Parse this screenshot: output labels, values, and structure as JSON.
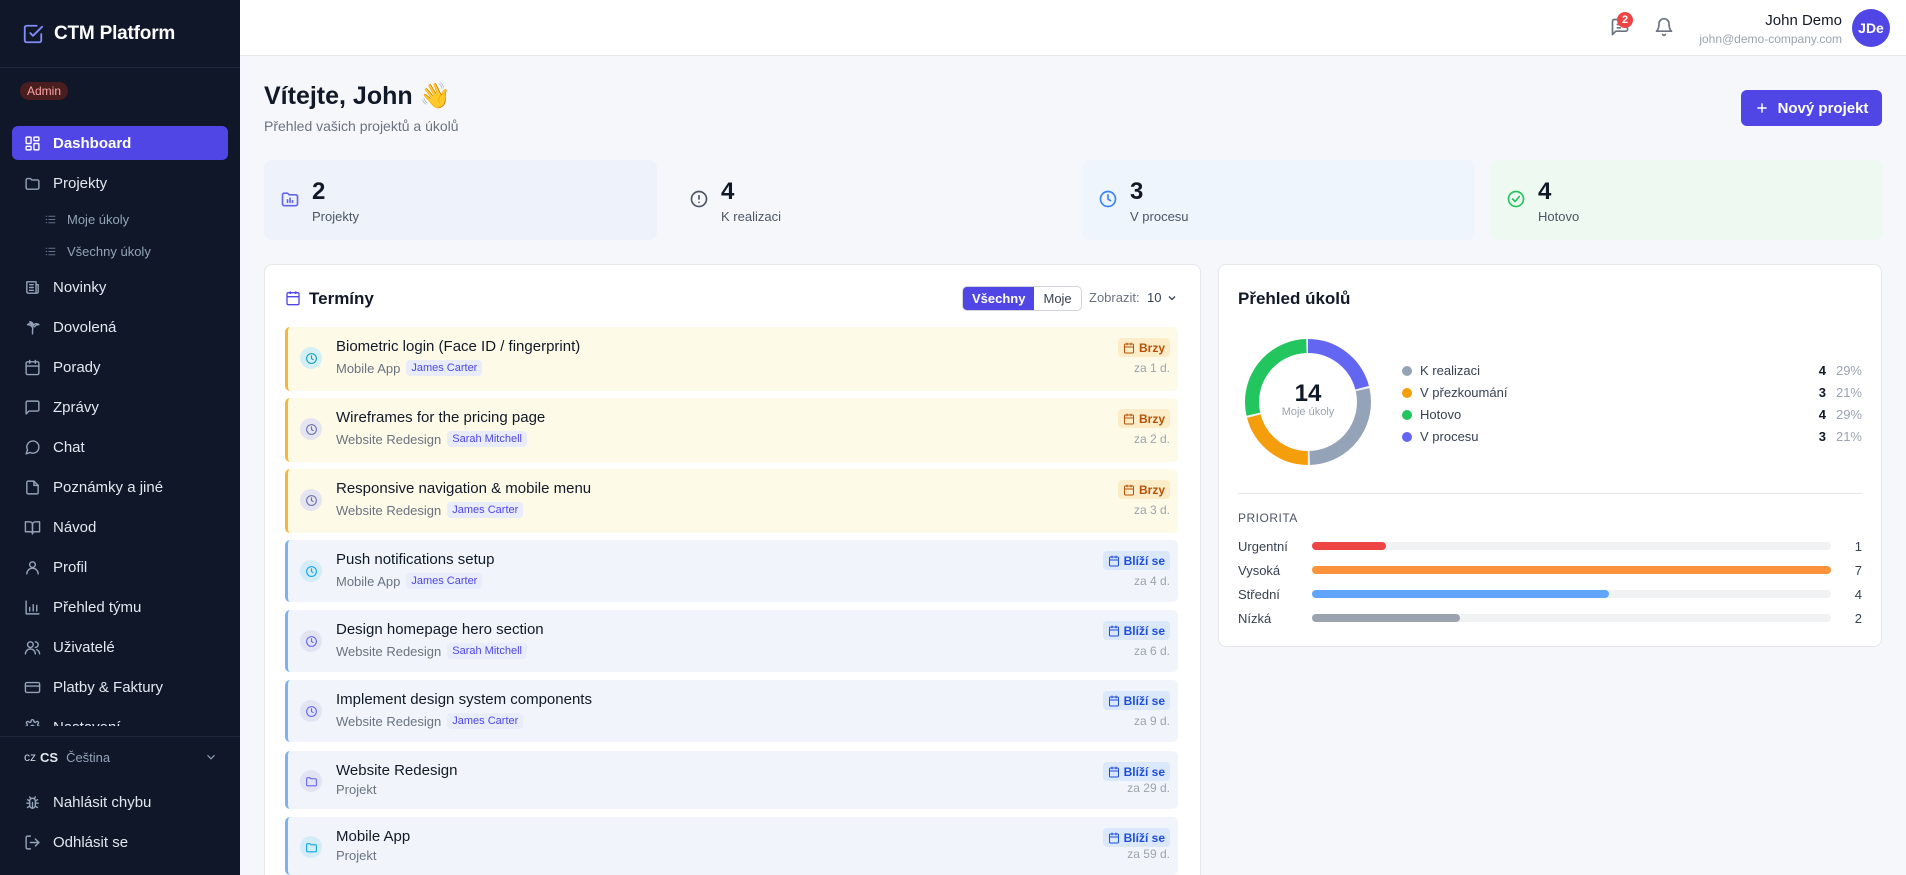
{
  "app": {
    "name": "CTM Platform",
    "role": "Admin"
  },
  "nav": [
    {
      "label": "Dashboard",
      "icon": "dashboard-icon",
      "active": true
    },
    {
      "label": "Projekty",
      "icon": "folder-icon"
    },
    {
      "label": "Moje úkoly",
      "icon": "list-icon",
      "sub": true
    },
    {
      "label": "Všechny úkoly",
      "icon": "list-icon",
      "sub": true
    },
    {
      "label": "Novinky",
      "icon": "newspaper-icon"
    },
    {
      "label": "Dovolená",
      "icon": "palm-icon"
    },
    {
      "label": "Porady",
      "icon": "calendar-icon"
    },
    {
      "label": "Zprávy",
      "icon": "message-icon"
    },
    {
      "label": "Chat",
      "icon": "chat-icon"
    },
    {
      "label": "Poznámky a jiné",
      "icon": "file-icon"
    },
    {
      "label": "Návod",
      "icon": "book-icon"
    },
    {
      "label": "Profil",
      "icon": "user-icon"
    },
    {
      "label": "Přehled týmu",
      "icon": "bar-chart-icon"
    },
    {
      "label": "Uživatelé",
      "icon": "users-icon"
    },
    {
      "label": "Platby & Faktury",
      "icon": "credit-card-icon"
    },
    {
      "label": "Nastavení",
      "icon": "gear-icon"
    }
  ],
  "language": {
    "flag": "cz",
    "code": "CS",
    "name": "Čeština"
  },
  "bottom": {
    "report": "Nahlásit chybu",
    "logout": "Odhlásit se"
  },
  "topbar": {
    "badge": "2",
    "user_name": "John Demo",
    "user_email": "john@demo-company.com",
    "avatar": "JDe"
  },
  "header": {
    "title": "Vítejte, John 👋",
    "subtitle": "Přehled vašich projektů a úkolů",
    "new_project": "Nový projekt"
  },
  "stats": [
    {
      "value": "2",
      "label": "Projekty",
      "icon": "folder-chart-icon",
      "bg": "#eef2fb",
      "color": "#6366f1"
    },
    {
      "value": "4",
      "label": "K realizaci",
      "icon": "alert-circle-icon",
      "bg": "#f5f7fb",
      "color": "#4b5563"
    },
    {
      "value": "3",
      "label": "V procesu",
      "icon": "clock-icon",
      "bg": "#eef5fd",
      "color": "#3b82f6"
    },
    {
      "value": "4",
      "label": "Hotovo",
      "icon": "check-circle-icon",
      "bg": "#eefaf1",
      "color": "#22c55e"
    }
  ],
  "deadlines": {
    "title": "Termíny",
    "filter_all": "Všechny",
    "filter_mine": "Moje",
    "show_label": "Zobrazit:",
    "show_value": "10",
    "items": [
      {
        "title": "Biometric login (Face ID / fingerprint)",
        "project": "Mobile App",
        "assignee": "James Carter",
        "tag": "Brzy",
        "due": "za 1 d.",
        "kind": "soon",
        "icon": "task",
        "icon_bg": "#d5f0f4",
        "icon_color": "#0e9fb5"
      },
      {
        "title": "Wireframes for the pricing page",
        "project": "Website Redesign",
        "assignee": "Sarah Mitchell",
        "tag": "Brzy",
        "due": "za 2 d.",
        "kind": "soon",
        "icon": "task",
        "icon_bg": "#e4e5f0",
        "icon_color": "#6b6fa8"
      },
      {
        "title": "Responsive navigation & mobile menu",
        "project": "Website Redesign",
        "assignee": "James Carter",
        "tag": "Brzy",
        "due": "za 3 d.",
        "kind": "soon",
        "icon": "task",
        "icon_bg": "#e4e5f0",
        "icon_color": "#6b6fa8"
      },
      {
        "title": "Push notifications setup",
        "project": "Mobile App",
        "assignee": "James Carter",
        "tag": "Blíží se",
        "due": "za 4 d.",
        "kind": "near",
        "icon": "task",
        "icon_bg": "#d3ecf8",
        "icon_color": "#0ea5e9"
      },
      {
        "title": "Design homepage hero section",
        "project": "Website Redesign",
        "assignee": "Sarah Mitchell",
        "tag": "Blíží se",
        "due": "za 6 d.",
        "kind": "near",
        "icon": "task",
        "icon_bg": "#e2e3f3",
        "icon_color": "#6366f1"
      },
      {
        "title": "Implement design system components",
        "project": "Website Redesign",
        "assignee": "James Carter",
        "tag": "Blíží se",
        "due": "za 9 d.",
        "kind": "near",
        "icon": "task",
        "icon_bg": "#e2e3f3",
        "icon_color": "#6366f1"
      },
      {
        "title": "Website Redesign",
        "project": "Projekt",
        "assignee": "",
        "tag": "Blíží se",
        "due": "za 29 d.",
        "kind": "near",
        "icon": "project",
        "icon_bg": "#e2e3f3",
        "icon_color": "#6366f1"
      },
      {
        "title": "Mobile App",
        "project": "Projekt",
        "assignee": "",
        "tag": "Blíží se",
        "due": "za 59 d.",
        "kind": "near",
        "icon": "project",
        "icon_bg": "#d3ecf8",
        "icon_color": "#0ea5e9"
      }
    ]
  },
  "overview": {
    "title": "Přehled úkolů",
    "total": "14",
    "total_label": "Moje úkoly",
    "status": [
      {
        "name": "K realizaci",
        "count": 4,
        "pct": "29%",
        "color": "#94a3b8"
      },
      {
        "name": "V přezkoumání",
        "count": 3,
        "pct": "21%",
        "color": "#f59e0b"
      },
      {
        "name": "Hotovo",
        "count": 4,
        "pct": "29%",
        "color": "#22c55e"
      },
      {
        "name": "V procesu",
        "count": 3,
        "pct": "21%",
        "color": "#6366f1"
      }
    ],
    "priority_title": "PRIORITA",
    "priority": [
      {
        "name": "Urgentní",
        "count": 1,
        "color": "#ef4444"
      },
      {
        "name": "Vysoká",
        "count": 7,
        "color": "#fb923c"
      },
      {
        "name": "Střední",
        "count": 4,
        "color": "#60a5fa"
      },
      {
        "name": "Nízká",
        "count": 2,
        "color": "#9ca3af"
      }
    ]
  }
}
